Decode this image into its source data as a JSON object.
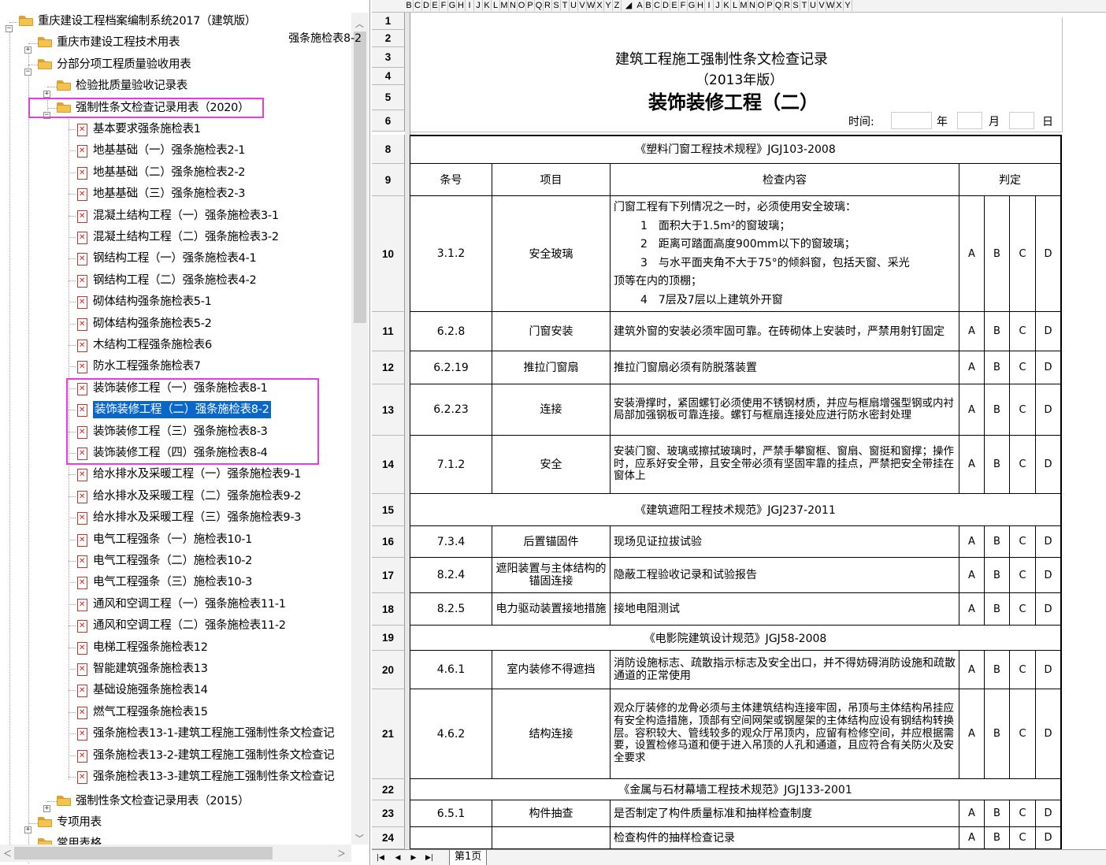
{
  "tree": {
    "root": "重庆建设工程档案编制系统2017（建筑版）",
    "n1": "重庆市建设工程技术用表",
    "n2": "分部分项工程质量验收用表",
    "n3": "检验批质量验收记录表",
    "n4": "强制性条文检查记录用表（2020）",
    "items": [
      "基本要求强条施检表1",
      "地基基础（一）强条施检表2-1",
      "地基基础（二）强条施检表2-2",
      "地基基础（三）强条施检表2-3",
      "混凝土结构工程（一）强条施检表3-1",
      "混凝土结构工程（二）强条施检表3-2",
      "钢结构工程（一）强条施检表4-1",
      "钢结构工程（二）强条施检表4-2",
      "砌体结构强条施检表5-1",
      "砌体结构强条施检表5-2",
      "木结构工程强条施检表6",
      "防水工程强条施检表7",
      "装饰装修工程（一）强条施检表8-1",
      "装饰装修工程（二）强条施检表8-2",
      "装饰装修工程（三）强条施检表8-3",
      "装饰装修工程（四）强条施检表8-4",
      "给水排水及采暖工程（一）强条施检表9-1",
      "给水排水及采暖工程（二）强条施检表9-2",
      "给水排水及采暖工程（三）强条施检表9-3",
      "电气工程强条（一）施检表10-1",
      "电气工程强条（二）施检表10-2",
      "电气工程强条（三）施检表10-3",
      "通风和空调工程（一）强条施检表11-1",
      "通风和空调工程（二）强条施检表11-2",
      "电梯工程强条施检表12",
      "智能建筑强条施检表13",
      "基础设施强条施检表14",
      "燃气工程强条施检表15",
      "强条施检表13-1-建筑工程施工强制性条文检查记",
      "强条施检表13-2-建筑工程施工强制性条文检查记",
      "强条施检表13-3-建筑工程施工强制性条文检查记"
    ],
    "n5": "强制性条文检查记录用表（2015）",
    "n6": "专项用表",
    "n7": "常用表格"
  },
  "sheet": {
    "cols_a": [
      "B",
      "C",
      "D",
      "E",
      "F",
      "G",
      "H",
      "I",
      "J",
      "K",
      "L",
      "M",
      "N",
      "O",
      "P",
      "Q",
      "R",
      "S",
      "T",
      "U",
      "V",
      "W",
      "X",
      "Y",
      "Z"
    ],
    "cols_b": [
      "A",
      "B",
      "C",
      "D",
      "E",
      "F",
      "G",
      "H",
      "I",
      "J",
      "K",
      "L",
      "M",
      "N",
      "O",
      "P",
      "Q",
      "R",
      "S",
      "T",
      "U",
      "V",
      "W",
      "X",
      "Y"
    ],
    "rows": [
      "1",
      "2",
      "3",
      "4",
      "5",
      "6",
      "8",
      "9",
      "10",
      "11",
      "12",
      "13",
      "14",
      "15",
      "16",
      "17",
      "18",
      "19",
      "20",
      "21",
      "22",
      "23",
      "24"
    ],
    "form_id": "强条施检表8-2",
    "title1": "建筑工程施工强制性条文检查记录",
    "title2": "（2013年版）",
    "title3": "装饰装修工程（二）",
    "time_label": "时间:",
    "year": "年",
    "month": "月",
    "day": "日",
    "s1": "《塑料门窗工程技术规程》JGJ103-2008",
    "h_no": "条号",
    "h_item": "项目",
    "h_content": "检查内容",
    "h_judge": "判定",
    "r10": {
      "no": "3.1.2",
      "item": "安全玻璃",
      "l1": "门窗工程有下列情况之一时，必须使用安全玻璃：",
      "l2": "1　面积大于1.5m²的窗玻璃；",
      "l3": "2　距离可踏面高度900mm以下的窗玻璃；",
      "l4": "3　与水平面夹角不大于75°的倾斜窗，包括天窗、采光",
      "l5": "顶等在内的顶棚；",
      "l6": "4　7层及7层以上建筑外开窗"
    },
    "r11": {
      "no": "6.2.8",
      "item": "门窗安装",
      "c": "建筑外窗的安装必须牢固可靠。在砖砌体上安装时，严禁用射钉固定"
    },
    "r12": {
      "no": "6.2.19",
      "item": "推拉门窗扇",
      "c": "推拉门窗扇必须有防脱落装置"
    },
    "r13": {
      "no": "6.2.23",
      "item": "连接",
      "c": "安装滑撑时，紧固螺钉必须使用不锈钢材质，并应与框扇增强型钢或内衬局部加强钢板可靠连接。螺钉与框扇连接处应进行防水密封处理"
    },
    "r14": {
      "no": "7.1.2",
      "item": "安全",
      "c": "安装门窗、玻璃或擦拭玻璃时，严禁手攀窗框、窗扇、窗挺和窗撑；操作时，应系好安全带，且安全带必须有坚固牢靠的挂点，严禁把安全带挂在窗体上"
    },
    "s2": "《建筑遮阳工程技术规范》JGJ237-2011",
    "r16": {
      "no": "7.3.4",
      "item": "后置锚固件",
      "c": "现场见证拉拔试验"
    },
    "r17": {
      "no": "8.2.4",
      "item": "遮阳装置与主体结构的锚固连接",
      "c": "隐蔽工程验收记录和试验报告"
    },
    "r18": {
      "no": "8.2.5",
      "item": "电力驱动装置接地措施",
      "c": "接地电阻测试"
    },
    "s3": "《电影院建筑设计规范》JGJ58-2008",
    "r20": {
      "no": "4.6.1",
      "item": "室内装修不得遮挡",
      "c": "消防设施标志、疏散指示标志及安全出口，并不得妨碍消防设施和疏散通道的正常使用"
    },
    "r21": {
      "no": "4.6.2",
      "item": "结构连接",
      "c": "观众厅装修的龙骨必须与主体建筑结构连接牢固，吊顶与主体结构吊挂应有安全构造措施，顶部有空间网架或钢屋架的主体结构应设有钢结构转换层。容积较大、管线较多的观众厅吊顶内，应留有检修空间，并应根据需要，设置检修马道和便于进入吊顶的人孔和通道，且应符合有关防火及安全要求"
    },
    "s4": "《金属与石材幕墙工程技术规范》JGJ133-2001",
    "r23": {
      "no": "6.5.1",
      "item": "构件抽查",
      "c": "是否制定了构件质量标准和抽样检查制度"
    },
    "r24": {
      "no": "",
      "item": "",
      "c": "检查构件的抽样检查记录"
    },
    "abcd": [
      "A",
      "B",
      "C",
      "D"
    ],
    "tab": "第1页"
  }
}
